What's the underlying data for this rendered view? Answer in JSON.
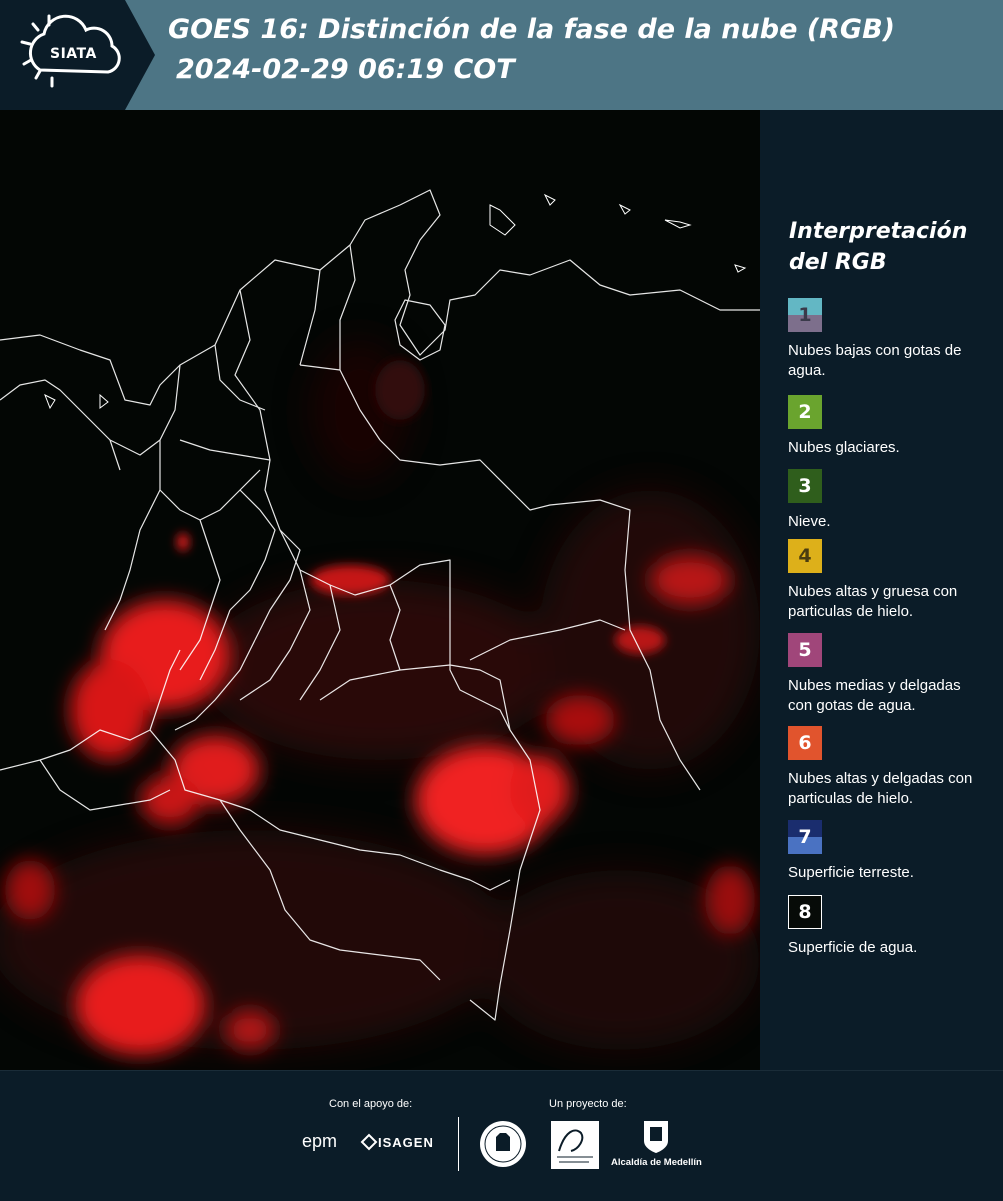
{
  "header": {
    "logo_text": "SIATA",
    "title_line1": "GOES 16: Distinción de la fase de la nube (RGB)",
    "title_line2": "2024-02-29 06:19 COT"
  },
  "legend": {
    "title": "Interpretación del RGB",
    "items": [
      {
        "number": "1",
        "label": "Nubes bajas con gotas de agua.",
        "color_top": "#63b7c4",
        "color_bottom": "#7d6f8c"
      },
      {
        "number": "2",
        "label": "Nubes glaciares.",
        "color": "#6aa42e"
      },
      {
        "number": "3",
        "label": "Nieve.",
        "color": "#2f5e1c"
      },
      {
        "number": "4",
        "label": "Nubes altas y gruesa con particulas de hielo.",
        "color": "#ddb01a"
      },
      {
        "number": "5",
        "label": "Nubes medias y delgadas con gotas de agua.",
        "color": "#a0467a"
      },
      {
        "number": "6",
        "label": "Nubes altas y delgadas con particulas de hielo.",
        "color": "#e1542d"
      },
      {
        "number": "7",
        "label": "Superficie terreste.",
        "color_top": "#1a2d6e",
        "color_bottom": "#4a72c2"
      },
      {
        "number": "8",
        "label": "Superficie de agua.",
        "color": "#070b08"
      }
    ]
  },
  "footer": {
    "support_label": "Con el apoyo de:",
    "project_label": "Un proyecto de:",
    "epm": "epm",
    "isagen": "ISAGEN",
    "alcaldia": "Alcaldía de Medellín"
  }
}
